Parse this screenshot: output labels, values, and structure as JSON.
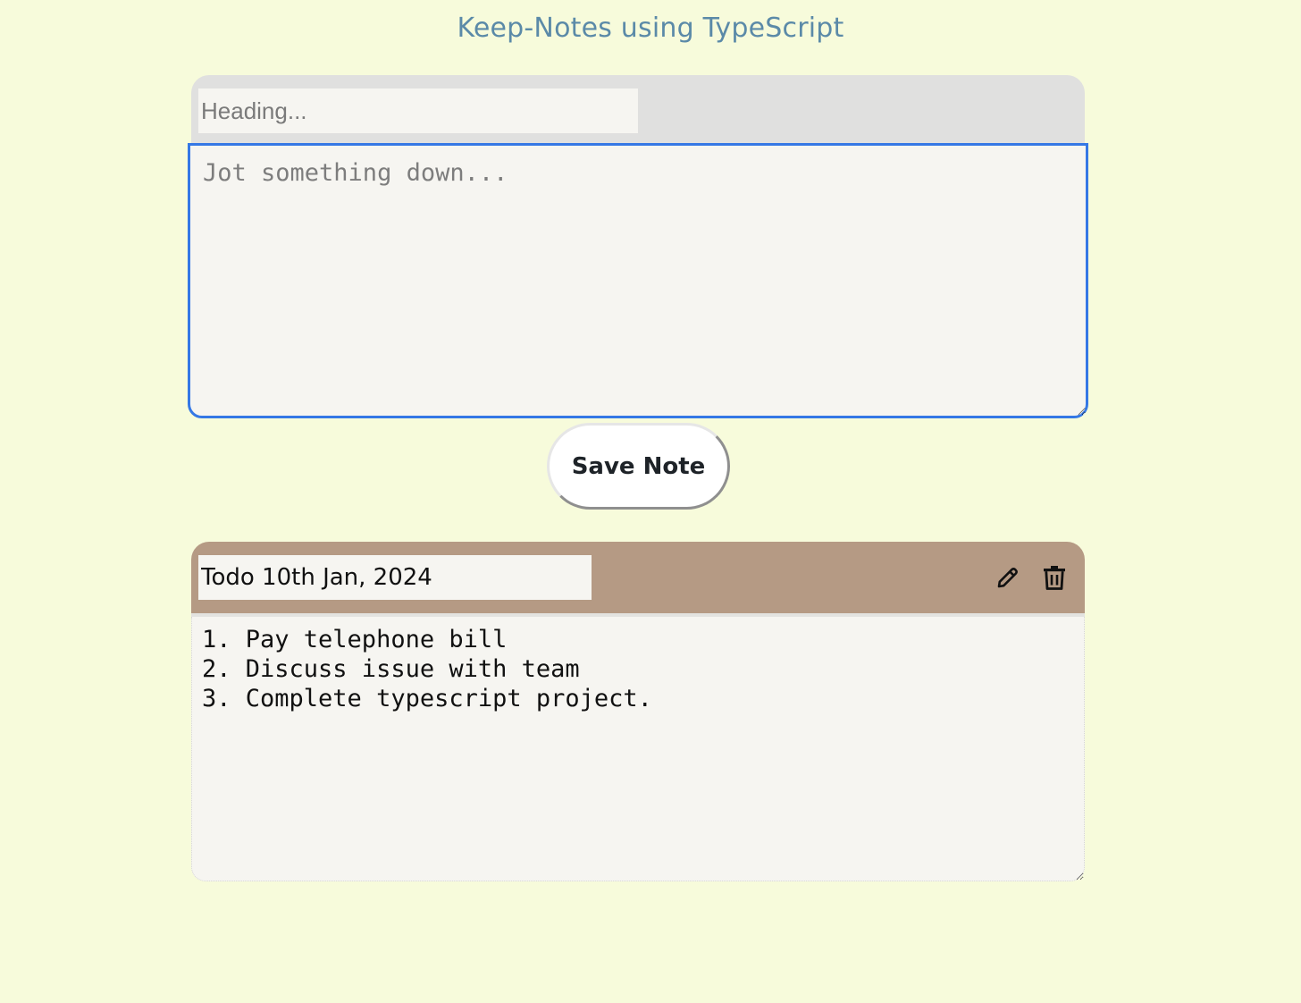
{
  "page": {
    "title": "Keep-Notes using TypeScript"
  },
  "composer": {
    "heading_placeholder": "Heading...",
    "heading_value": "",
    "body_placeholder": "Jot something down...",
    "body_value": "",
    "save_label": "Save Note"
  },
  "notes": [
    {
      "title": "Todo 10th Jan, 2024",
      "body": "1. Pay telephone bill\n2. Discuss issue with team\n3. Complete typescript project.",
      "edit_icon": "pencil-icon",
      "delete_icon": "trash-icon"
    }
  ],
  "colors": {
    "background": "#f7fbdb",
    "title": "#5b8aa8",
    "composer_header": "#e0e0df",
    "note_header": "#b59a84",
    "focus_ring": "#3578e5"
  }
}
